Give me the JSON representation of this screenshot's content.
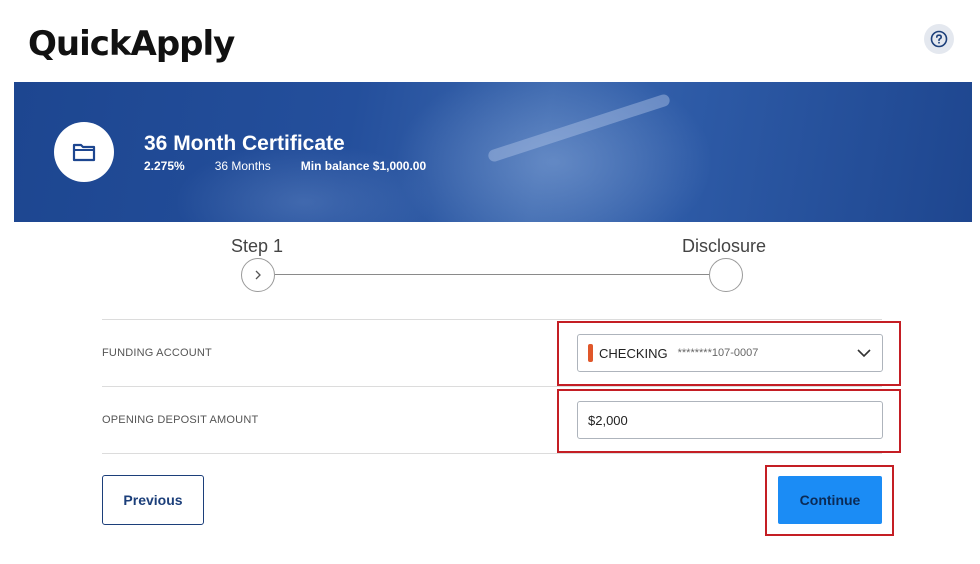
{
  "header": {
    "logo": "QuickApply",
    "help_icon": "question-circle-icon"
  },
  "product": {
    "icon": "folder-icon",
    "title": "36 Month Certificate",
    "rate": "2.275%",
    "term": "36 Months",
    "min_balance": "Min balance $1,000.00"
  },
  "steps": [
    {
      "label": "Step 1",
      "icon": "chevron-right-icon",
      "state": "current"
    },
    {
      "label": "Disclosure",
      "state": "upcoming"
    }
  ],
  "form": {
    "funding_account": {
      "label": "FUNDING ACCOUNT",
      "account_name": "CHECKING",
      "account_number": "********107-0007",
      "icon": "chevron-down-icon",
      "accent_color": "#e0572a"
    },
    "opening_deposit": {
      "label": "OPENING DEPOSIT AMOUNT",
      "value": "$2,000"
    }
  },
  "actions": {
    "previous": "Previous",
    "continue": "Continue"
  },
  "colors": {
    "banner": "#244f9c",
    "primary_button": "#1b8cf5",
    "highlight": "#c41e24",
    "outline_button": "#1c3f7a"
  }
}
